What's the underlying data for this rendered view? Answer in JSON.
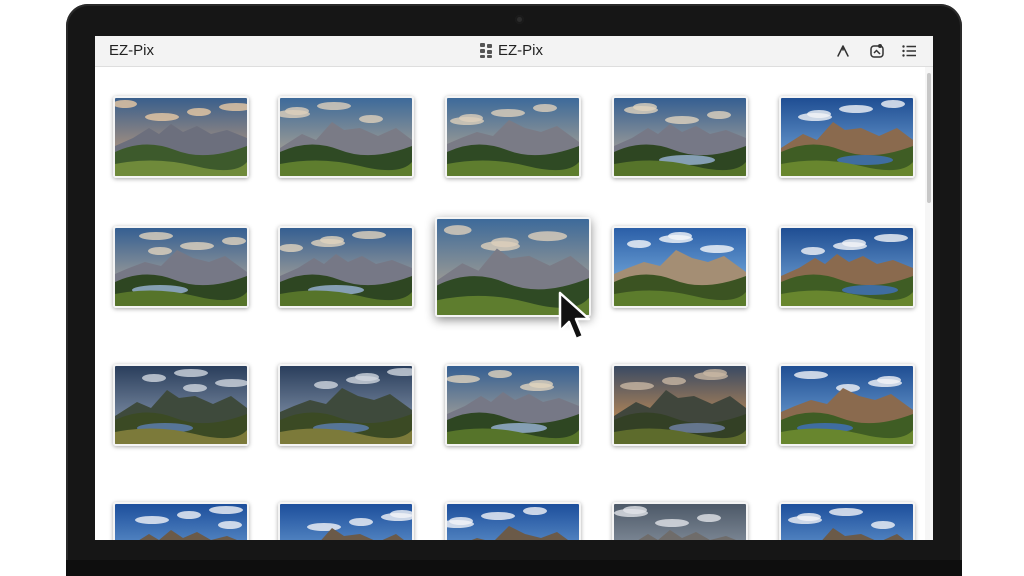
{
  "window": {
    "title_left": "EZ-Pix",
    "title_center": "EZ-Pix",
    "toolbar_icons": [
      "sort-icon",
      "add-photo-icon",
      "list-view-icon"
    ]
  },
  "gallery": {
    "rows": 4,
    "columns": 5,
    "selected_index": 7,
    "thumbnails": [
      {
        "scene": "mountains-sunset"
      },
      {
        "scene": "mountains-valley"
      },
      {
        "scene": "mountains-valley"
      },
      {
        "scene": "mountains-lake"
      },
      {
        "scene": "mountain-lake-blue"
      },
      {
        "scene": "mountains-lake"
      },
      {
        "scene": "mountains-lake"
      },
      {
        "scene": "mountains-valley"
      },
      {
        "scene": "cliff-blue-sky"
      },
      {
        "scene": "mountain-lake-blue"
      },
      {
        "scene": "lake-dramatic-sky"
      },
      {
        "scene": "lake-dramatic-sky"
      },
      {
        "scene": "mountains-lake"
      },
      {
        "scene": "sunset-lake"
      },
      {
        "scene": "mountain-lake-blue"
      },
      {
        "scene": "blue-sky-hills"
      },
      {
        "scene": "blue-sky-hills"
      },
      {
        "scene": "blue-sky-hills"
      },
      {
        "scene": "cloudy-peaks"
      },
      {
        "scene": "blue-sky-hills"
      }
    ]
  },
  "colors": {
    "bezel": "#161616",
    "titlebar": "#f3f3f3",
    "screen": "#ffffff"
  }
}
